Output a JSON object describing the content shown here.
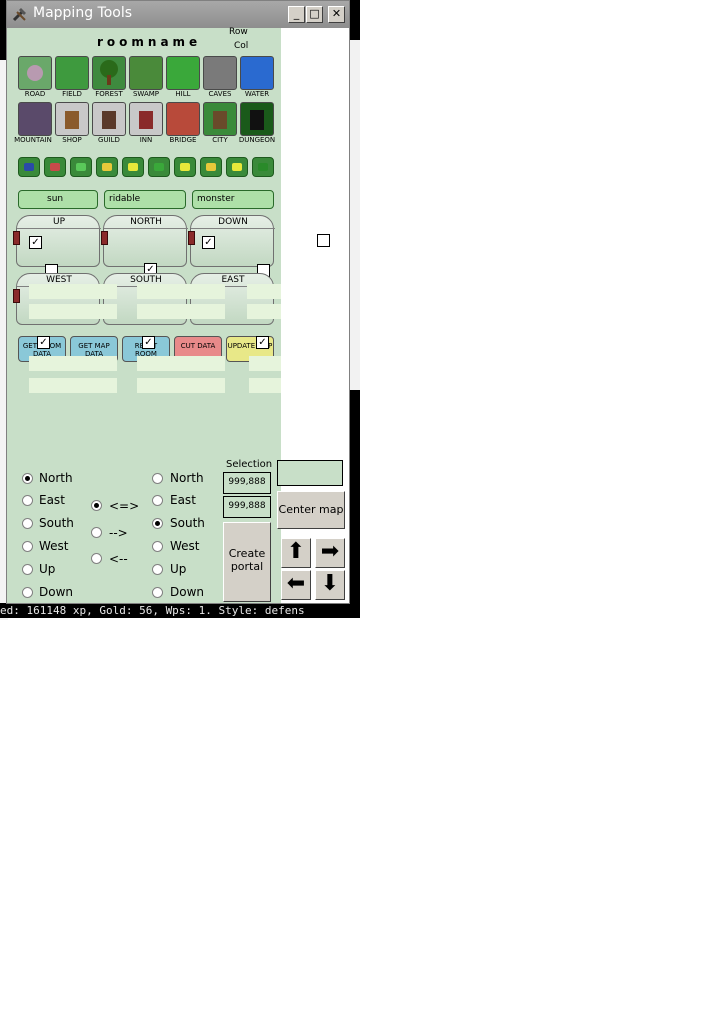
{
  "window": {
    "title": "Mapping Tools",
    "minimize": "_",
    "maximize": "□",
    "close": "✕"
  },
  "header": {
    "roomname": "roomname",
    "row_label": "Row",
    "col_label": "Col"
  },
  "terrain_row1": [
    "ROAD",
    "FIELD",
    "FOREST",
    "SWAMP",
    "HILL",
    "CAVES",
    "WATER"
  ],
  "terrain_row2": [
    "MOUNTAIN",
    "SHOP",
    "GUILD",
    "INN",
    "BRIDGE",
    "CITY",
    "DUNGEON"
  ],
  "flags": {
    "sun": "sun",
    "ridable": "ridable",
    "monster": "monster"
  },
  "exits": {
    "up": "UP",
    "north": "NORTH",
    "down": "DOWN",
    "west": "WEST",
    "south": "SOUTH",
    "east": "EAST"
  },
  "actions": {
    "get_room": "GET ROOM DATA",
    "get_map": "GET MAP DATA",
    "reset_room": "RESET ROOM",
    "cut": "CUT DATA",
    "update": "UPDATE MAP"
  },
  "directions_left": [
    "North",
    "East",
    "South",
    "West",
    "Up",
    "Down"
  ],
  "directions_left_selected": "North",
  "link_modes": [
    "<=>",
    "-->",
    "<--"
  ],
  "link_mode_selected": "<=>",
  "directions_right": [
    "North",
    "East",
    "South",
    "West",
    "Up",
    "Down"
  ],
  "directions_right_selected": "South",
  "selection": {
    "label": "Selection",
    "value1": "999,888",
    "value2": "999,888"
  },
  "buttons": {
    "center_map": "Center map",
    "create_portal_1": "Create",
    "create_portal_2": "portal"
  },
  "status_line": "ed: 161148 xp, Gold: 56, Wps: 1. Style: defens",
  "colors": {
    "panel": "#c8dfc8",
    "titlebar": "#9a9a9a",
    "cut": "#e88a8a",
    "update": "#e8e888",
    "blue_btn": "#8ac8d8"
  }
}
